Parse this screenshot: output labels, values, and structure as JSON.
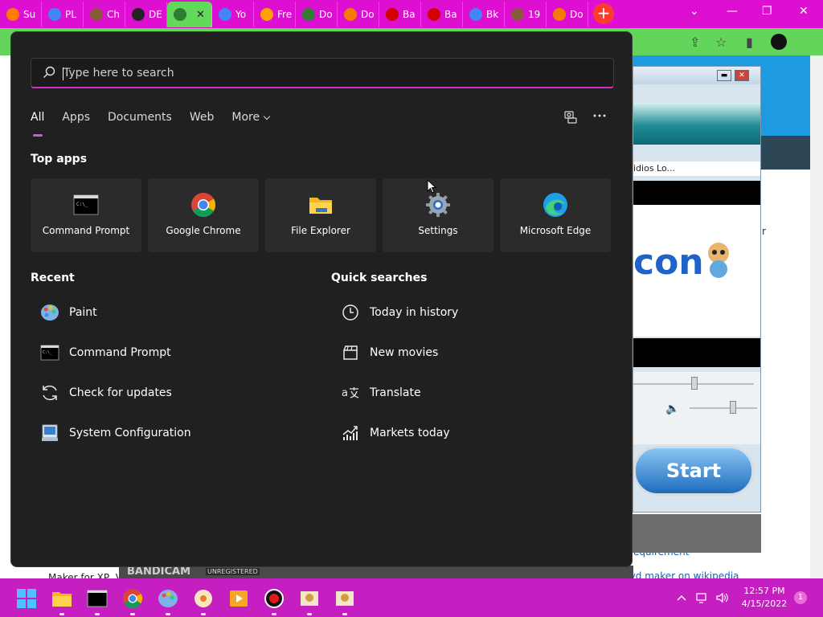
{
  "browser": {
    "tabs": [
      {
        "label": "Su",
        "color": "#ff7a00"
      },
      {
        "label": "PL",
        "color": "#4285f4"
      },
      {
        "label": "Ch",
        "color": "#8a5a3c"
      },
      {
        "label": "DE",
        "color": "#222222"
      },
      {
        "label": "",
        "color": "#2e7d32",
        "active": true
      },
      {
        "label": "Yo",
        "color": "#4285f4"
      },
      {
        "label": "Fre",
        "color": "#ffa000"
      },
      {
        "label": "Do",
        "color": "#2e7d32"
      },
      {
        "label": "Do",
        "color": "#f57c00"
      },
      {
        "label": "Ba",
        "color": "#d50000"
      },
      {
        "label": "Ba",
        "color": "#d50000"
      },
      {
        "label": "Bk",
        "color": "#4285f4"
      },
      {
        "label": "19",
        "color": "#8a5a3c"
      },
      {
        "label": "Do",
        "color": "#f57c00"
      }
    ],
    "new_tab": "+"
  },
  "background": {
    "page_texts": [
      "r",
      "Maker for XP, V",
      "s dvd maker on wikipedia",
      "equirement"
    ],
    "bandicam_strip": "idios Lo...",
    "bandicam_logo": "con",
    "bandicam_start": "Start",
    "bandicam_brand": "BANDICAM",
    "bandicam_unreg": "UNREGISTERED"
  },
  "start_menu": {
    "search_placeholder": "Type here to search",
    "filter_tabs": [
      {
        "label": "All",
        "active": true
      },
      {
        "label": "Apps"
      },
      {
        "label": "Documents"
      },
      {
        "label": "Web"
      },
      {
        "label": "More"
      }
    ],
    "top_apps_title": "Top apps",
    "top_apps": [
      {
        "label": "Command Prompt",
        "icon": "command-prompt-icon"
      },
      {
        "label": "Google Chrome",
        "icon": "chrome-icon"
      },
      {
        "label": "File Explorer",
        "icon": "folder-icon"
      },
      {
        "label": "Settings",
        "icon": "gear-icon"
      },
      {
        "label": "Microsoft Edge",
        "icon": "edge-icon"
      }
    ],
    "recent_title": "Recent",
    "recent": [
      {
        "label": "Paint",
        "icon": "paint-icon"
      },
      {
        "label": "Command Prompt",
        "icon": "command-prompt-icon"
      },
      {
        "label": "Check for updates",
        "icon": "refresh-icon"
      },
      {
        "label": "System Configuration",
        "icon": "system-config-icon"
      }
    ],
    "quick_title": "Quick searches",
    "quick": [
      {
        "label": "Today in history",
        "icon": "clock-icon"
      },
      {
        "label": "New movies",
        "icon": "clapperboard-icon"
      },
      {
        "label": "Translate",
        "icon": "translate-icon"
      },
      {
        "label": "Markets today",
        "icon": "chart-icon"
      }
    ]
  },
  "taskbar": {
    "time": "12:57 PM",
    "date": "4/15/2022",
    "notifications": "1",
    "accent": "#c51fc1"
  }
}
